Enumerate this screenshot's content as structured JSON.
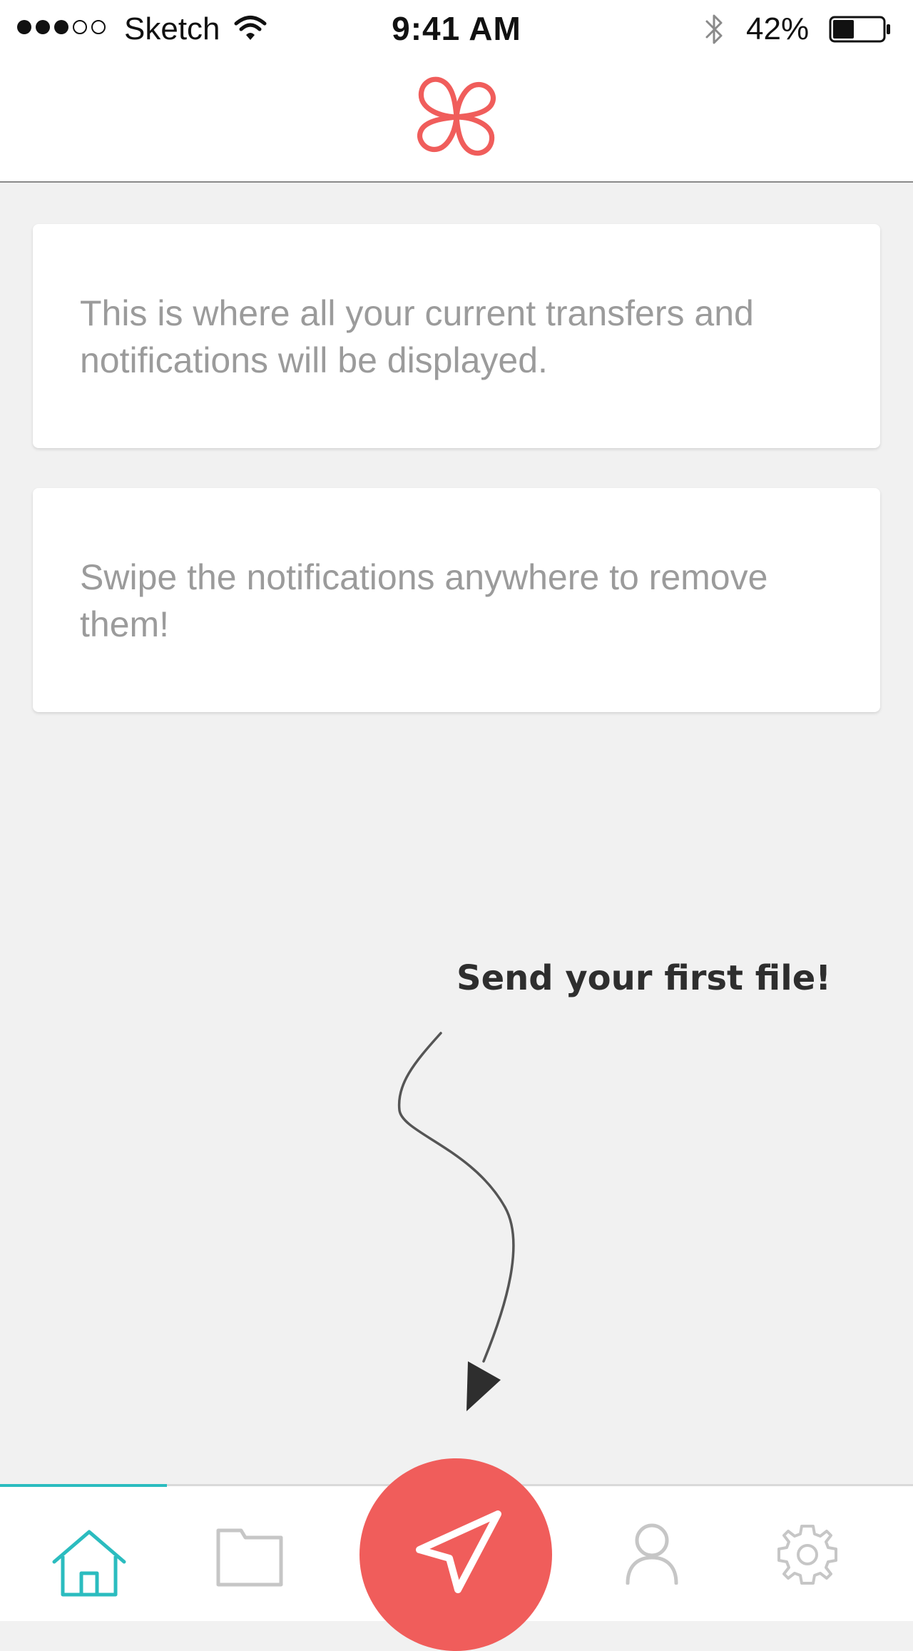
{
  "status_bar": {
    "signal_full": 3,
    "signal_total": 5,
    "carrier": "Sketch",
    "time": "9:41 AM",
    "battery_percent_label": "42%",
    "battery_level": 0.42
  },
  "header": {
    "logo_icon": "clover-logo-icon",
    "brand_color": "#f05d5b"
  },
  "cards": [
    {
      "text": "This is where all your current transfers and notifications will be displayed."
    },
    {
      "text": "Swipe the notifications anywhere to remove them!"
    }
  ],
  "hint": {
    "text": "Send your first file!"
  },
  "tab_bar": {
    "active_tab": "home",
    "accent_color": "#2bbcbf",
    "inactive_color": "#c6c6c6",
    "tabs": [
      {
        "id": "home",
        "icon": "home-icon"
      },
      {
        "id": "files",
        "icon": "folder-icon"
      },
      {
        "id": "send",
        "icon": "send-arrow-icon"
      },
      {
        "id": "profile",
        "icon": "person-icon"
      },
      {
        "id": "settings",
        "icon": "gear-icon"
      }
    ]
  }
}
